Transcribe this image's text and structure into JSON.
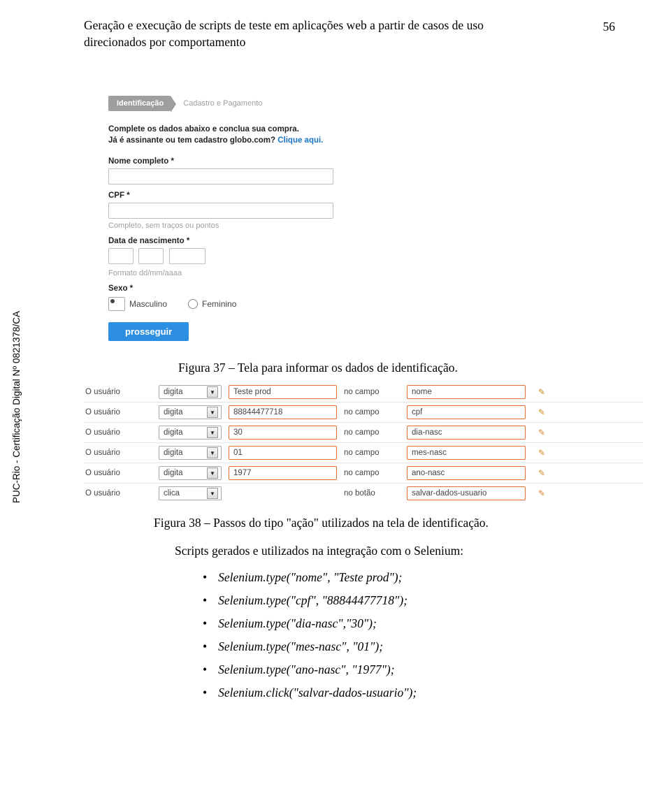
{
  "header": {
    "title_line1": "Geração e execução de scripts de teste em aplicações web a partir de casos de uso",
    "title_line2": "direcionados por comportamento",
    "page_number": "56"
  },
  "form": {
    "breadcrumb": {
      "step1": "Identificação",
      "step2": "Cadastro e Pagamento"
    },
    "lead_bold1": "Complete os dados abaixo e conclua sua compra.",
    "lead_bold2": "Já é assinante ou tem cadastro globo.com?",
    "lead_link": "Clique aqui.",
    "nome_lbl": "Nome completo *",
    "cpf_lbl": "CPF *",
    "cpf_hint": "Completo, sem traços ou pontos",
    "dob_lbl": "Data de nascimento *",
    "dob_hint": "Formato dd/mm/aaaa",
    "sexo_lbl": "Sexo *",
    "sexo_m": "Masculino",
    "sexo_f": "Feminino",
    "btn": "prosseguir"
  },
  "fig37_caption": "Figura 37 – Tela para informar os dados de identificação.",
  "steps": [
    {
      "actor": "O usuário",
      "verb": "digita",
      "val": "Teste prod",
      "prep": "no campo",
      "field": "nome",
      "has_pencil": true,
      "val_boxed": true,
      "field_boxed": true
    },
    {
      "actor": "O usuário",
      "verb": "digita",
      "val": "88844477718",
      "prep": "no campo",
      "field": "cpf",
      "has_pencil": true,
      "val_boxed": true,
      "field_boxed": true
    },
    {
      "actor": "O usuário",
      "verb": "digita",
      "val": "30",
      "prep": "no campo",
      "field": "dia-nasc",
      "has_pencil": true,
      "val_boxed": true,
      "field_boxed": true
    },
    {
      "actor": "O usuário",
      "verb": "digita",
      "val": "01",
      "prep": "no campo",
      "field": "mes-nasc",
      "has_pencil": true,
      "val_boxed": true,
      "field_boxed": true
    },
    {
      "actor": "O usuário",
      "verb": "digita",
      "val": "1977",
      "prep": "no campo",
      "field": "ano-nasc",
      "has_pencil": true,
      "val_boxed": true,
      "field_boxed": true
    },
    {
      "actor": "O usuário",
      "verb": "clica",
      "val": "",
      "prep": "no botão",
      "field": "salvar-dados-usuario",
      "has_pencil": true,
      "val_boxed": false,
      "field_boxed": true
    }
  ],
  "fig38_caption": "Figura 38 – Passos do tipo \"ação\" utilizados na tela de identificação.",
  "body": {
    "intro": "Scripts gerados e utilizados na integração com o Selenium:",
    "items": [
      "Selenium.type(\"nome\", \"Teste prod\");",
      "Selenium.type(\"cpf\", \"88844477718\");",
      "Selenium.type(\"dia-nasc\",\"30\");",
      "Selenium.type(\"mes-nasc\", \"01\");",
      "Selenium.type(\"ano-nasc\", \"1977\");",
      "Selenium.click(\"salvar-dados-usuario\");"
    ]
  },
  "sidebar": "PUC-Rio - Certificação Digital Nº 0821378/CA"
}
